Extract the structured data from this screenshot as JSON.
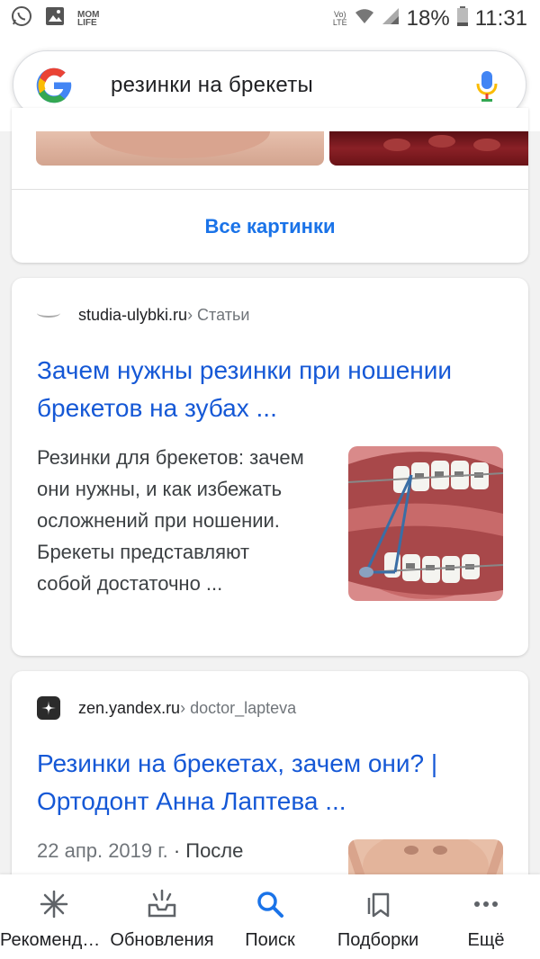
{
  "status_bar": {
    "carrier_badge": "MOM\nLIFE",
    "network": "Vo)\nLTE",
    "battery": "18%",
    "time": "11:31"
  },
  "search": {
    "query": "резинки на брекеты"
  },
  "images_card": {
    "all_images_label": "Все картинки"
  },
  "results": [
    {
      "source_domain": "studia-ulybki.ru",
      "source_path": " › Статьи",
      "title": "Зачем нужны резинки при ношении брекетов на зубах ...",
      "snippet": "Резинки для брекетов: зачем они нужны, и как избежать осложнений при ношении. Брекеты представляют собой достаточно ..."
    },
    {
      "source_domain": "zen.yandex.ru",
      "source_path": " › doctor_lapteva",
      "title": "Резинки на брекетах, зачем они? | Ортодонт Анна Лаптева ...",
      "date": "22 апр. 2019 г.",
      "snippet": " · После"
    }
  ],
  "bottom_nav": [
    {
      "label": "Рекомендации",
      "icon": "asterisk-icon"
    },
    {
      "label": "Обновления",
      "icon": "inbox-updates-icon"
    },
    {
      "label": "Поиск",
      "icon": "search-icon"
    },
    {
      "label": "Подборки",
      "icon": "collections-icon"
    },
    {
      "label": "Ещё",
      "icon": "more-dots-icon"
    }
  ],
  "colors": {
    "link_blue": "#1558d6",
    "accent_blue": "#1a73e8",
    "background": "#f2f2f2"
  }
}
